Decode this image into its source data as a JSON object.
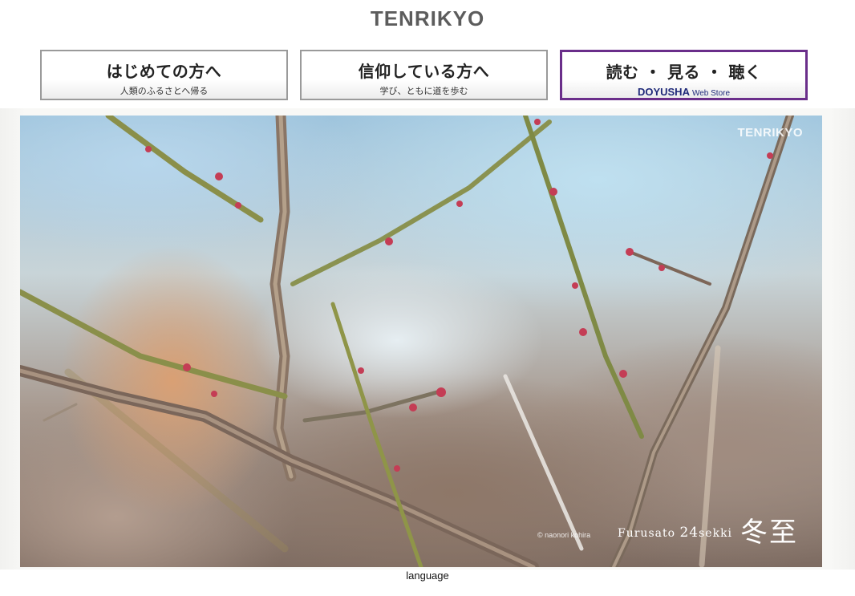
{
  "header": {
    "logo": "TENRIKYO"
  },
  "nav": [
    {
      "title": "はじめての方へ",
      "subtitle": "人類のふるさとへ帰る"
    },
    {
      "title": "信仰している方へ",
      "subtitle": "学び、ともに道を歩む"
    },
    {
      "title": "読む ・ 見る ・ 聴く",
      "brand": "DOYUSHA",
      "subtitle": "Web Store",
      "accent_color": "#6a2e8a"
    }
  ],
  "hero": {
    "watermark": "TENRIKYO",
    "credit": "© naonori kohira",
    "series_label": "Furusato",
    "series_number": "24",
    "series_suffix": "sekki",
    "season": "冬至"
  },
  "footer": {
    "language_label": "language"
  }
}
